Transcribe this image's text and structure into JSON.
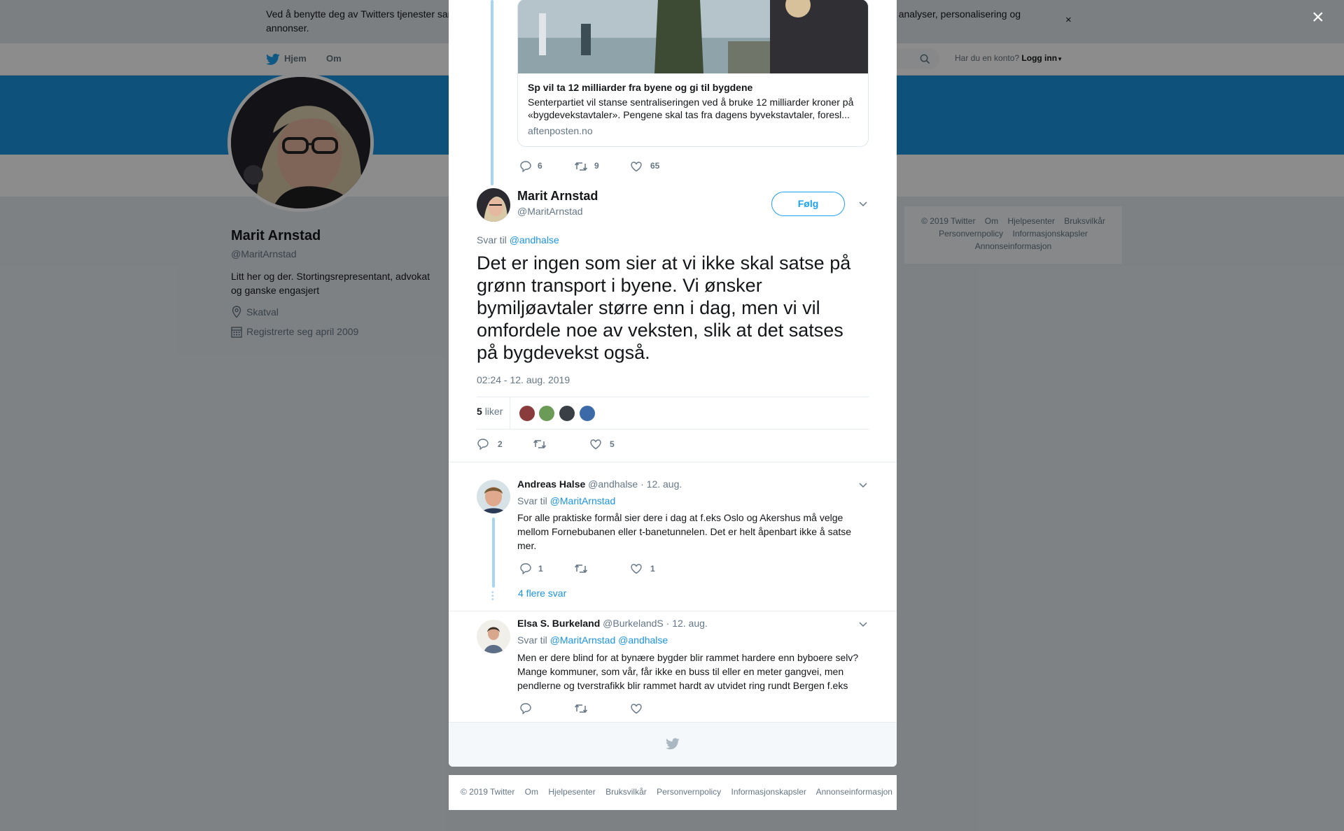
{
  "cookie_banner": {
    "text": "Ved å benytte deg av Twitters tjenester samtykker du i bruken av informasjonskapsler. Twitter og våre partnere bruker informasjonskapsler til bl.a. analyser, personalisering og annonser.",
    "close": "×"
  },
  "nav": {
    "home": "Hjem",
    "about": "Om",
    "account_prompt": "Har du en konto?",
    "login": "Logg inn"
  },
  "profile": {
    "name": "Marit Arnstad",
    "handle": "@MaritArnstad",
    "bio": "Litt her og der. Stortingsrepresentant, advokat og ganske engasjert",
    "location": "Skatval",
    "joined": "Registrerte seg april 2009"
  },
  "side_footer": [
    "© 2019 Twitter",
    "Om",
    "Hjelpesenter",
    "Bruksvilkår",
    "Personvernpolicy",
    "Informasjonskapsler",
    "Annonseinformasjon"
  ],
  "overlay_close": "×",
  "quoted_tweet": {
    "card_title": "Sp vil ta 12 milliarder fra byene og gi til bygdene",
    "card_desc": "Senterpartiet vil stanse sentraliseringen ved å bruke 12 milliarder kroner på «bygdevekstavtaler». Pengene skal tas fra dagens byvekstavtaler, foresl...",
    "card_domain": "aftenposten.no",
    "replies": "6",
    "retweets": "9",
    "likes": "65"
  },
  "main_tweet": {
    "name": "Marit Arnstad",
    "handle": "@MaritArnstad",
    "follow": "Følg",
    "reply_prefix": "Svar til",
    "reply_to": "@andhalse",
    "text": "Det er ingen som sier at vi ikke skal satse på grønn transport i byene. Vi ønsker bymiljøavtaler større enn i dag, men vi vil omfordele noe av veksten, slik at det satses på bygdevekst også.",
    "timestamp": "02:24 - 12. aug. 2019",
    "likes_count": "5",
    "likes_label": "liker",
    "replies": "2",
    "retweets": "",
    "likes": "5"
  },
  "replies": [
    {
      "name": "Andreas Halse",
      "handle": "@andhalse",
      "date": "· 12. aug.",
      "reply_prefix": "Svar til",
      "reply_to": "@MaritArnstad",
      "reply_to2": "",
      "text": "For alle praktiske formål sier dere i dag at f.eks Oslo og Akershus må velge mellom Fornebubanen eller t-banetunnelen. Det er helt åpenbart ikke å satse mer.",
      "replies": "1",
      "retweets": "",
      "likes": "1",
      "more": "4 flere svar"
    },
    {
      "name": "Elsa S. Burkeland",
      "handle": "@BurkelandS",
      "date": "· 12. aug.",
      "reply_prefix": "Svar til",
      "reply_to": "@MaritArnstad",
      "reply_to2": "@andhalse",
      "text": "Men er dere blind for at bynære bygder blir rammet hardere enn byboere selv? Mange kommuner, som vår, får ikke en buss til eller en meter gangvei, men pendlerne og tverstrafikk blir rammet hardt av utvidet ring rundt Bergen f.eks",
      "replies": "",
      "retweets": "",
      "likes": ""
    }
  ],
  "modal_footer": [
    "© 2019 Twitter",
    "Om",
    "Hjelpesenter",
    "Bruksvilkår",
    "Personvernpolicy",
    "Informasjonskapsler",
    "Annonseinformasjon"
  ],
  "colors": {
    "brand": "#1da1f2",
    "banner": "#1b95e0",
    "link": "#1b95e0",
    "text": "#14171a",
    "muted": "#657786"
  }
}
